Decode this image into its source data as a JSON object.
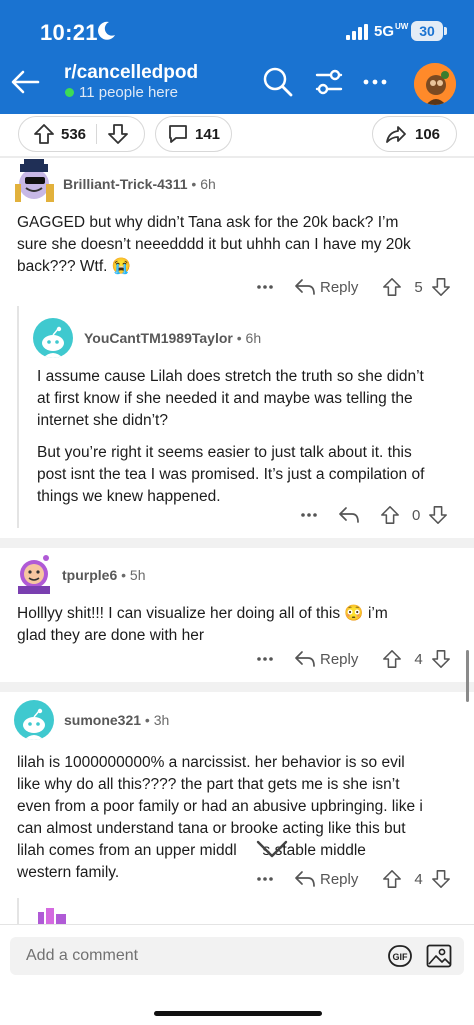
{
  "status_bar": {
    "time": "10:21",
    "network": "5G",
    "network_sub": "UW",
    "battery": "30"
  },
  "header": {
    "subreddit": "r/cancelledpod",
    "online": "11 people here",
    "brand_color": "#1a73d1"
  },
  "post_actions": {
    "upvotes": "536",
    "comments": "141",
    "shares": "106"
  },
  "comments": [
    {
      "author": "Brilliant-Trick-4311",
      "age": "6h",
      "lines": [
        "GAGGED but why didn’t Tana ask for the 20k back? I’m",
        "sure she doesn’t neeedddd it but uhhh can I have my 20k",
        "back??? Wtf. 😭"
      ],
      "reply_label": "Reply",
      "votes": "5"
    },
    {
      "author": "YouCantTM1989Taylor",
      "age": "6h",
      "lines": [
        "I assume cause Lilah does stretch the truth so she didn’t",
        "at first know if she needed it and maybe was telling the",
        "internet she didn’t?"
      ],
      "lines2": [
        "But you’re right it seems easier to just talk about it. this",
        "post isnt the tea I was promised. It’s just a compilation of",
        "things we knew happened."
      ],
      "votes": "0"
    },
    {
      "author": "tpurple6",
      "age": "5h",
      "lines": [
        "Holllyy shit!!!  I can visualize her doing all of this 😳 i’m",
        "glad they are done with her"
      ],
      "reply_label": "Reply",
      "votes": "4"
    },
    {
      "author": "sumone321",
      "age": "3h",
      "lines": [
        "lilah is 1000000000% a narcissist. her behavior is so evil",
        "like why do all this???? the part that gets me is she isn’t",
        "even from a poor family or had an abusive upbringing. like i",
        "can almost understand tana or brooke acting like this but",
        "lilah comes from an upper middl      s stable middle",
        "western family."
      ],
      "reply_label": "Reply",
      "votes": "4"
    }
  ],
  "comment_bar": {
    "placeholder": "Add a comment",
    "gif_label": "GIF"
  }
}
